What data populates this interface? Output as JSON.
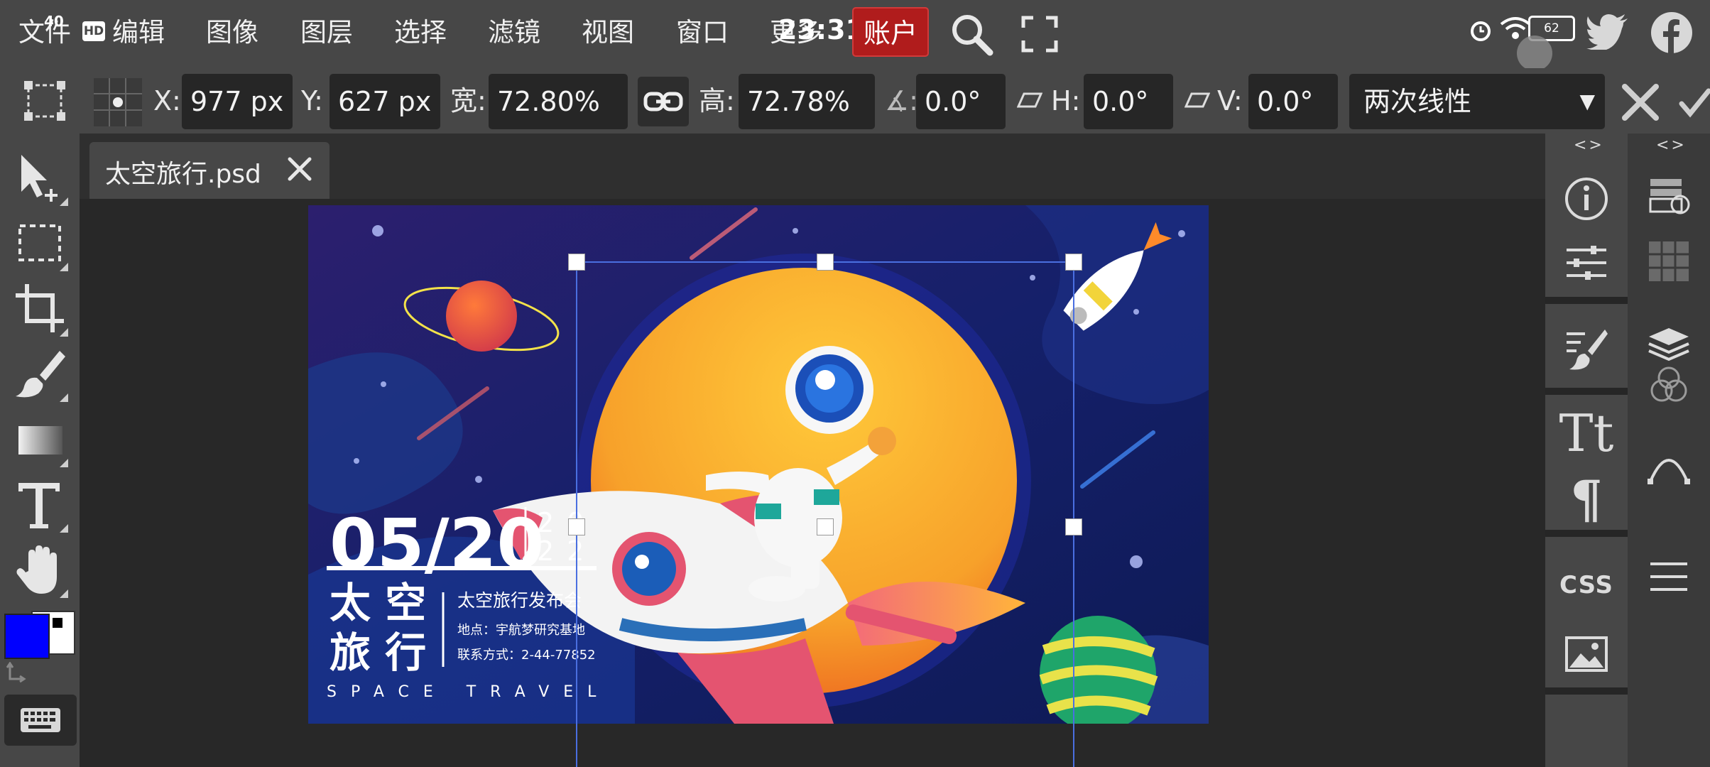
{
  "menubar": {
    "items": [
      "文件",
      "编辑",
      "图像",
      "图层",
      "选择",
      "滤镜",
      "视图",
      "窗口",
      "更多"
    ],
    "account_label": "账户",
    "status_time": "23:31",
    "status_speed": "40",
    "status_battery": "62"
  },
  "options": {
    "x_label": "X:",
    "x_value": "977 px",
    "y_label": "Y:",
    "y_value": "627 px",
    "w_label": "宽:",
    "w_value": "72.80%",
    "h_label": "高:",
    "h_value": "72.78%",
    "angle_label": "∡:",
    "angle_value": "0.0°",
    "skew_h_label": "H:",
    "skew_h_value": "0.0°",
    "skew_v_label": "V:",
    "skew_v_value": "0.0°",
    "interpolation": "两次线性"
  },
  "document": {
    "tab_title": "太空旅行.psd"
  },
  "poster": {
    "date": "05/20",
    "year_top": "20",
    "year_bottom": "22",
    "title_line1": "太 空",
    "title_line2": "旅 行",
    "event_name": "太空旅行发布会",
    "location": "地点：宇航梦研究基地",
    "contact": "联系方式：2-44-77852",
    "english": "SPACE TRAVEL"
  },
  "colors": {
    "foreground": "#0000ff",
    "background": "#ffffff",
    "accent_account": "#b01c1c"
  },
  "panels": {
    "css_label": "CSS"
  }
}
